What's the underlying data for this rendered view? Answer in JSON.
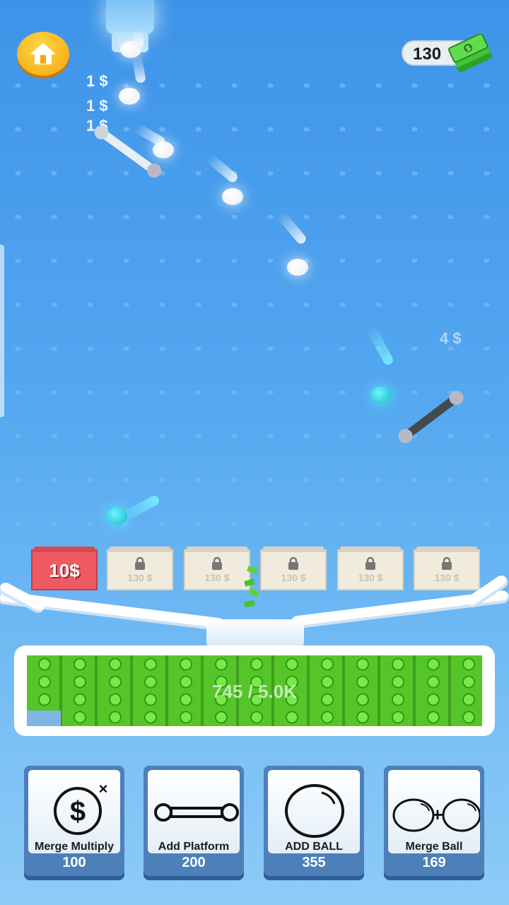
{
  "hud": {
    "money": "130",
    "home_icon": "home-icon",
    "money_icon": "cash-stack-icon"
  },
  "floating_earnings": [
    "1 $",
    "1 $",
    "1 $",
    "4 $"
  ],
  "boxes": [
    {
      "price": "10$",
      "locked": false
    },
    {
      "price": "130 $",
      "locked": true
    },
    {
      "price": "130 $",
      "locked": true
    },
    {
      "price": "130 $",
      "locked": true
    },
    {
      "price": "130 $",
      "locked": true
    },
    {
      "price": "130 $",
      "locked": true
    }
  ],
  "tank": {
    "progress_text": "745 / 5.0K",
    "fill_fraction": 0.149
  },
  "shop": [
    {
      "title": "Merge Multiply",
      "cost": "100",
      "icon": "dollar-multiply-icon"
    },
    {
      "title": "Add Platform",
      "cost": "200",
      "icon": "platform-icon"
    },
    {
      "title": "ADD BALL",
      "cost": "355",
      "icon": "ball-icon"
    },
    {
      "title": "Merge Ball",
      "cost": "169",
      "icon": "merge-ball-icon"
    }
  ],
  "colors": {
    "ball_white": "#ffffff",
    "ball_teal": "#14b8c8",
    "active_box": "#ef5a63",
    "cash_green": "#5fd233",
    "shop_button": "#4d7fb8"
  }
}
